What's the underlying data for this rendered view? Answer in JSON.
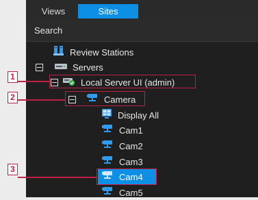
{
  "tabs": [
    {
      "label": "Views"
    },
    {
      "label": "Sites"
    }
  ],
  "search": {
    "label": "Search"
  },
  "tree": {
    "review_stations": "Review Stations",
    "servers": "Servers",
    "local_server": "Local Server UI (admin)",
    "camera_group": "Camera",
    "display_all": "Display All",
    "cams": [
      "Cam1",
      "Cam2",
      "Cam3",
      "Cam4",
      "Cam5"
    ]
  },
  "callouts": [
    "1",
    "2",
    "3"
  ],
  "colors": {
    "accent": "#0d8fe6",
    "callout": "#c21f45",
    "panel": "#1f1f1f",
    "selected": "#0d8fe6"
  }
}
